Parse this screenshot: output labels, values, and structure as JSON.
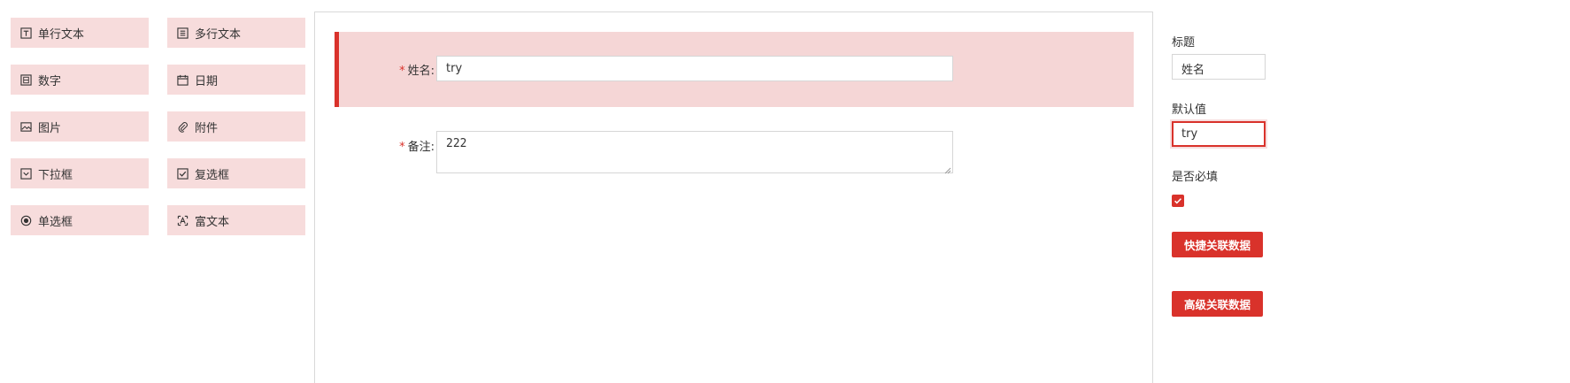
{
  "palette": {
    "items": [
      {
        "label": "单行文本",
        "icon": "text-box-icon"
      },
      {
        "label": "多行文本",
        "icon": "list-box-icon"
      },
      {
        "label": "数字",
        "icon": "number-box-icon"
      },
      {
        "label": "日期",
        "icon": "calendar-icon"
      },
      {
        "label": "图片",
        "icon": "image-icon"
      },
      {
        "label": "附件",
        "icon": "paperclip-icon"
      },
      {
        "label": "下拉框",
        "icon": "dropdown-box-icon"
      },
      {
        "label": "复选框",
        "icon": "checkbox-icon"
      },
      {
        "label": "单选框",
        "icon": "radio-icon"
      },
      {
        "label": "富文本",
        "icon": "rich-text-icon"
      }
    ]
  },
  "canvas": {
    "fields": [
      {
        "label": "姓名:",
        "required_mark": "*",
        "value": "try",
        "selected": true
      },
      {
        "label": "备注:",
        "required_mark": "*",
        "value": "222",
        "selected": false
      }
    ]
  },
  "properties": {
    "title_label": "标题",
    "title_value": "姓名",
    "default_label": "默认值",
    "default_value": "try",
    "required_label": "是否必填",
    "required_checked": true,
    "quick_link_button": "快捷关联数据",
    "advanced_link_button": "高级关联数据"
  },
  "colors": {
    "accent": "#d9322b",
    "palette_bg": "#f7dcdc",
    "selected_bg": "#f5d6d6"
  }
}
